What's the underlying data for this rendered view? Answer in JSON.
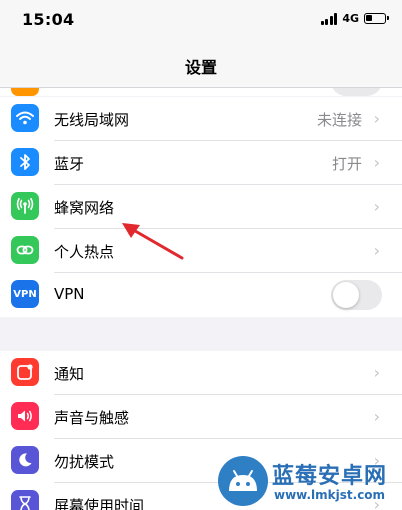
{
  "status_bar": {
    "time": "15:04",
    "network": "4G"
  },
  "nav": {
    "title": "设置"
  },
  "network_group": [
    {
      "label": "无线局域网",
      "value": "未连接",
      "icon": "wifi-icon",
      "icon_color": "#1a8cff"
    },
    {
      "label": "蓝牙",
      "value": "打开",
      "icon": "bluetooth-icon",
      "icon_color": "#1a8cff"
    },
    {
      "label": "蜂窝网络",
      "value": "",
      "icon": "cellular-antenna-icon",
      "icon_color": "#34c759"
    },
    {
      "label": "个人热点",
      "value": "",
      "icon": "personal-hotspot-icon",
      "icon_color": "#34c759"
    },
    {
      "label": "VPN",
      "icon_text": "VPN",
      "icon": "vpn-icon",
      "icon_color": "#1a73e8",
      "toggle_on": false
    }
  ],
  "notify_group": [
    {
      "label": "通知",
      "icon": "notifications-icon",
      "icon_color": "#ff3b30"
    },
    {
      "label": "声音与触感",
      "icon": "speaker-icon",
      "icon_color": "#ff2d55"
    },
    {
      "label": "勿扰模式",
      "icon": "moon-icon",
      "icon_color": "#5856d6"
    },
    {
      "label": "屏幕使用时间",
      "icon": "hourglass-icon",
      "icon_color": "#5856d6"
    }
  ],
  "watermark": {
    "title": "蓝莓安卓网",
    "url": "www.lmkjst.com"
  },
  "colors": {
    "chevron": "#c4c4c8",
    "annotation_arrow": "#e0282e"
  }
}
